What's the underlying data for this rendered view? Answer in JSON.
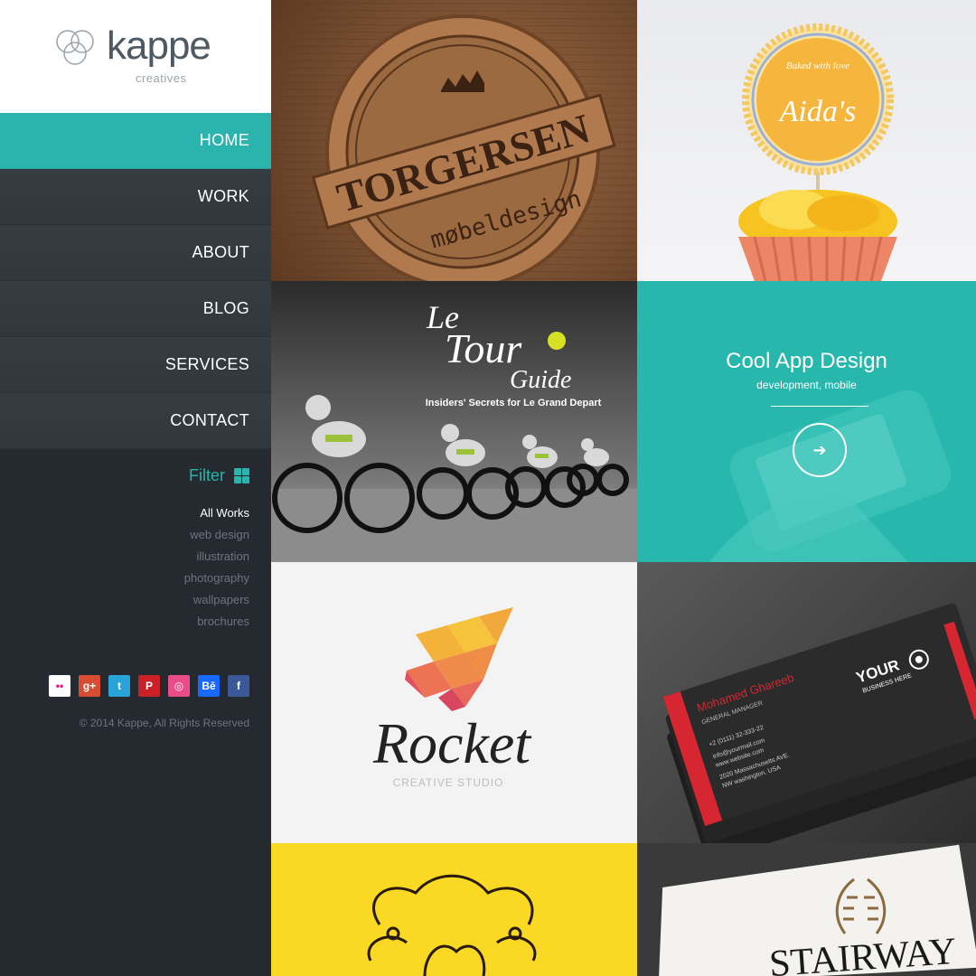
{
  "brand": {
    "name": "kappe",
    "tagline": "creatives"
  },
  "nav": {
    "items": [
      {
        "label": "HOME",
        "active": true
      },
      {
        "label": "WORK"
      },
      {
        "label": "ABOUT"
      },
      {
        "label": "BLOG"
      },
      {
        "label": "SERVICES"
      },
      {
        "label": "CONTACT"
      }
    ]
  },
  "filter": {
    "title": "Filter",
    "items": [
      "All Works",
      "web design",
      "illustration",
      "photography",
      "wallpapers",
      "brochures"
    ],
    "selected": "All Works"
  },
  "socials": [
    {
      "icon": "flickr-icon",
      "glyph": "••",
      "color": "#ffffff"
    },
    {
      "icon": "google-plus-icon",
      "glyph": "g+",
      "color": "#d64d33"
    },
    {
      "icon": "twitter-icon",
      "glyph": "t",
      "color": "#2aa3d8"
    },
    {
      "icon": "pinterest-icon",
      "glyph": "P",
      "color": "#cb2027"
    },
    {
      "icon": "dribbble-icon",
      "glyph": "◎",
      "color": "#ea4c89"
    },
    {
      "icon": "behance-icon",
      "glyph": "Bē",
      "color": "#1769ff"
    },
    {
      "icon": "facebook-icon",
      "glyph": "f",
      "color": "#3b5998"
    }
  ],
  "copyright": "© 2014 Kappe, All Rights Reserved",
  "tiles": {
    "torgersen": {
      "title": "TORGERSEN",
      "sub": "møbeldesign"
    },
    "aidas": {
      "top": "Baked with love",
      "name": "Aida's"
    },
    "tour": {
      "line1": "Le",
      "line2": "Tour",
      "line3": "Guide",
      "sub": "Insiders' Secrets for Le Grand Depart"
    },
    "cool": {
      "title": "Cool App Design",
      "sub": "development, mobile",
      "button_icon": "arrow-right-icon"
    },
    "rocket": {
      "name": "Rocket",
      "sub": "CREATIVE STUDIO"
    },
    "card": {
      "name": "Mohamed Ghareeb",
      "role": "GENERAL MANAGER",
      "phone": "+2 (0111) 32-333-22",
      "email": "info@yourmail.com",
      "web": "www.website.com",
      "addr1": "2020 Massachusetts AVE.",
      "addr2": "NW washington, USA",
      "your": "YOUR",
      "biz": "BUSINESS HERE"
    },
    "stairway": {
      "name": "STAIRWAY"
    }
  }
}
